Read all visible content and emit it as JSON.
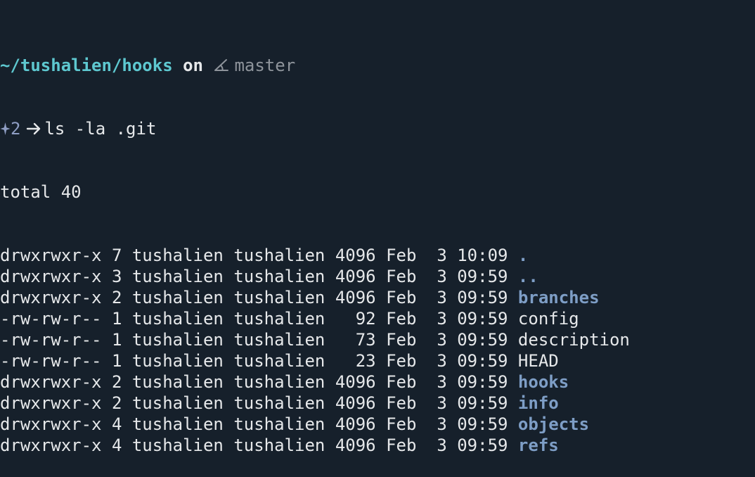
{
  "prompt": {
    "cwd": "~/tushalien/hooks",
    "on_word": "on",
    "branch_icon": "git-branch-icon",
    "branch": "master",
    "jobs_icon": "sparkle-icon",
    "jobs_count": "2",
    "arrow_icon": "right-arrow-icon",
    "command": "ls -la .git"
  },
  "output": {
    "total_line": "total 40",
    "rows": [
      {
        "meta": "drwxrwxr-x 7 tushalien tushalien 4096 Feb  3 10:09 ",
        "name": ".",
        "type": "dir"
      },
      {
        "meta": "drwxrwxr-x 3 tushalien tushalien 4096 Feb  3 09:59 ",
        "name": "..",
        "type": "dir"
      },
      {
        "meta": "drwxrwxr-x 2 tushalien tushalien 4096 Feb  3 09:59 ",
        "name": "branches",
        "type": "dir"
      },
      {
        "meta": "-rw-rw-r-- 1 tushalien tushalien   92 Feb  3 09:59 ",
        "name": "config",
        "type": "file"
      },
      {
        "meta": "-rw-rw-r-- 1 tushalien tushalien   73 Feb  3 09:59 ",
        "name": "description",
        "type": "file"
      },
      {
        "meta": "-rw-rw-r-- 1 tushalien tushalien   23 Feb  3 09:59 ",
        "name": "HEAD",
        "type": "file"
      },
      {
        "meta": "drwxrwxr-x 2 tushalien tushalien 4096 Feb  3 09:59 ",
        "name": "hooks",
        "type": "dir"
      },
      {
        "meta": "drwxrwxr-x 2 tushalien tushalien 4096 Feb  3 09:59 ",
        "name": "info",
        "type": "dir"
      },
      {
        "meta": "drwxrwxr-x 4 tushalien tushalien 4096 Feb  3 09:59 ",
        "name": "objects",
        "type": "dir"
      },
      {
        "meta": "drwxrwxr-x 4 tushalien tushalien 4096 Feb  3 09:59 ",
        "name": "refs",
        "type": "dir"
      }
    ]
  },
  "colors": {
    "background": "#16202b",
    "text": "#e6e8ea",
    "cwd": "#5ec8d0",
    "branch": "#8e949b",
    "directory": "#7e9ec6",
    "jobs": "#8f9ec4"
  }
}
